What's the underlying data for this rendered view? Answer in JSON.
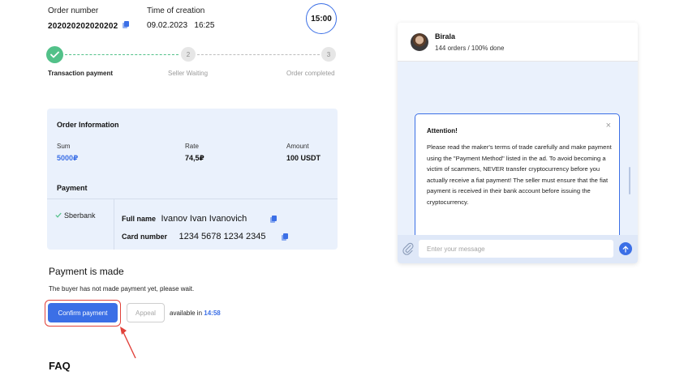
{
  "order": {
    "number_label": "Order number",
    "number_value": "202020202020202",
    "time_label": "Time of creation",
    "time_value": "09.02.2023   16:25",
    "timer": "15:00"
  },
  "steps": [
    {
      "label": "Transaction payment",
      "marker": "",
      "status": "done"
    },
    {
      "label": "Seller Waiting",
      "marker": "2",
      "status": "pending"
    },
    {
      "label": "Order completed",
      "marker": "3",
      "status": "pending"
    }
  ],
  "order_info": {
    "title": "Order Information",
    "sum_label": "Sum",
    "sum_value": "5000₽",
    "rate_label": "Rate",
    "rate_value": "74,5₽",
    "amount_label": "Amount",
    "amount_value": "100 USDT",
    "payment_title": "Payment",
    "bank": "Sberbank",
    "full_name_label": "Full name",
    "full_name_value": "Ivanov Ivan Ivanovich",
    "card_label": "Card number",
    "card_value": "1234 5678 1234 2345"
  },
  "payment_status": {
    "title": "Payment is made",
    "note": "The buyer has not made payment yet, please wait.",
    "confirm_label": "Confirm payment",
    "appeal_label": "Appeal",
    "available_text": "available in",
    "available_time": "14:58"
  },
  "faq": {
    "title": "FAQ"
  },
  "chat": {
    "name": "Birala",
    "stats": "144 orders / 100% done",
    "alert_title": "Attention!",
    "alert_close": "×",
    "alert_text": "Please read the maker's terms of trade carefully and make payment using the \"Payment Method\" listed in the ad. To avoid becoming a victim of scammers, NEVER transfer cryptocurrency before you actually receive a fiat payment! The seller must ensure that the fiat payment is received in their bank account before issuing the cryptocurrency.",
    "input_placeholder": "Enter your message"
  },
  "colors": {
    "accent": "#3b6fe6",
    "success": "#52c189",
    "highlight": "#e1413a",
    "panel": "#eaf1fc"
  }
}
